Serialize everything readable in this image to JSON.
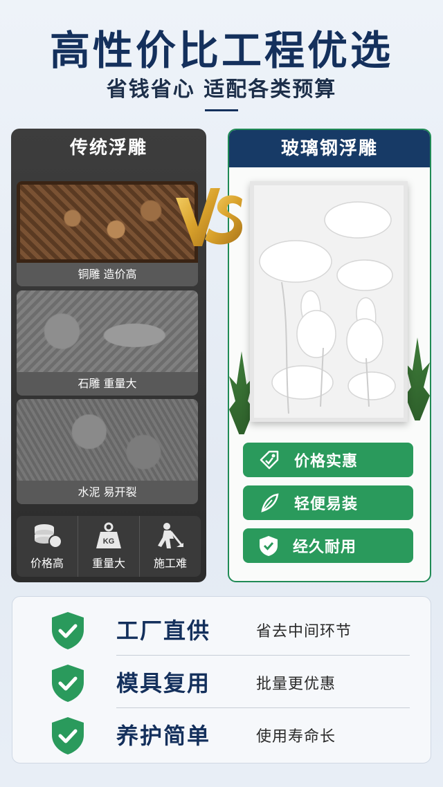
{
  "header": {
    "title": "高性价比工程优选",
    "subtitle": "省钱省心 适配各类预算"
  },
  "left": {
    "heading": "传统浮雕",
    "cards": [
      {
        "caption": "铜雕 造价高"
      },
      {
        "caption": "石雕 重量大"
      },
      {
        "caption": "水泥 易开裂"
      }
    ],
    "icons": [
      {
        "icon": "coin-stack-icon",
        "label": "价格高"
      },
      {
        "icon": "kg-weight-icon",
        "label": "重量大",
        "badge": "KG"
      },
      {
        "icon": "worker-digging-icon",
        "label": "施工难"
      }
    ]
  },
  "vs_label": "VS",
  "right": {
    "heading": "玻璃钢浮雕",
    "benefits": [
      {
        "icon": "price-tag-icon",
        "label": "价格实惠"
      },
      {
        "icon": "feather-icon",
        "label": "轻便易装"
      },
      {
        "icon": "shield-check-icon",
        "label": "经久耐用"
      }
    ]
  },
  "bottom": {
    "rows": [
      {
        "main": "工厂直供",
        "side": "省去中间环节"
      },
      {
        "main": "模具复用",
        "side": "批量更优惠"
      },
      {
        "main": "养护简单",
        "side": "使用寿命长"
      }
    ]
  },
  "colors": {
    "navy": "#14305c",
    "green": "#2a9a5c",
    "gold": "#e0b040"
  }
}
